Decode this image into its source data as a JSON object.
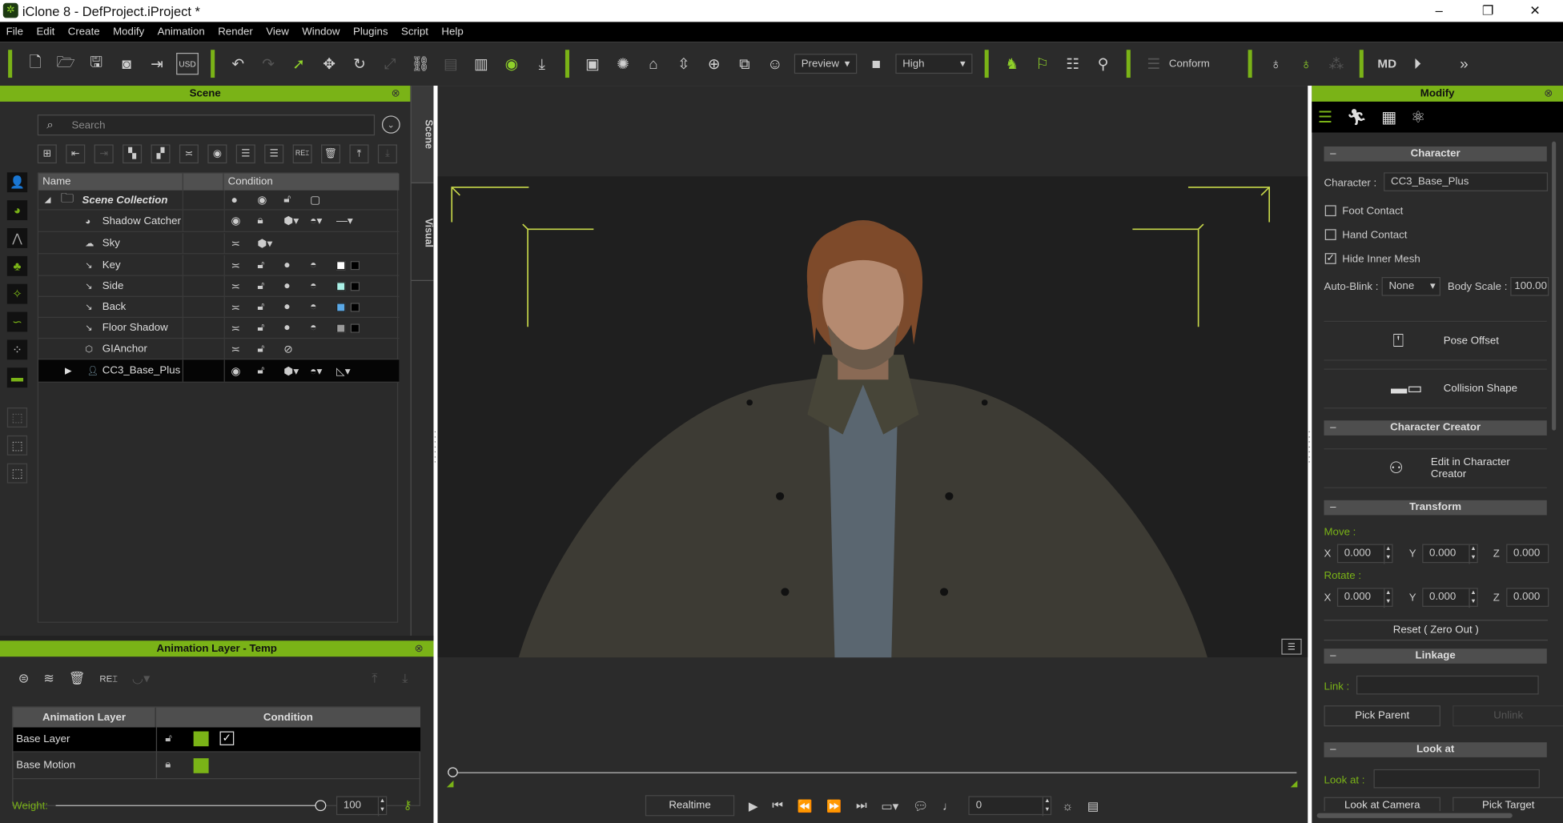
{
  "window": {
    "title": "iClone 8 - DefProject.iProject *",
    "controls": [
      "–",
      "❐",
      "✕"
    ]
  },
  "menu": [
    "File",
    "Edit",
    "Create",
    "Modify",
    "Animation",
    "Render",
    "View",
    "Window",
    "Plugins",
    "Script",
    "Help"
  ],
  "toolbar": {
    "preview_mode": "Preview",
    "quality": "High",
    "conform_label": "Conform"
  },
  "scene_panel": {
    "title": "Scene",
    "search_placeholder": "Search",
    "side_tabs": [
      "Scene",
      "Visual"
    ],
    "columns": [
      "Name",
      "Condition"
    ],
    "rows": [
      {
        "name": "Scene Collection",
        "icon": "folder-icon"
      },
      {
        "name": "Shadow Catcher",
        "icon": "shadow-catcher-icon"
      },
      {
        "name": "Sky",
        "icon": "cloud-icon"
      },
      {
        "name": "Key",
        "icon": "light-icon",
        "color": "#ffffff"
      },
      {
        "name": "Side",
        "icon": "light-icon",
        "color": "#aaf0e6"
      },
      {
        "name": "Back",
        "icon": "light-icon",
        "color": "#5aa8e6"
      },
      {
        "name": "Floor Shadow",
        "icon": "light-icon",
        "color": "#9a9a9a"
      },
      {
        "name": "GIAnchor",
        "icon": "anchor-icon"
      },
      {
        "name": "CC3_Base_Plus",
        "icon": "person-icon",
        "selected": true
      }
    ]
  },
  "anim_layer": {
    "title": "Animation Layer - Temp",
    "columns": [
      "Animation Layer",
      "Condition"
    ],
    "rows": [
      {
        "name": "Base Layer",
        "checked": true
      },
      {
        "name": "Base Motion",
        "checked": false
      }
    ],
    "weight_label": "Weight:",
    "weight": "100",
    "weight_fraction": 1.0,
    "layer_color": "#7ab317"
  },
  "timeline": {
    "realtime_label": "Realtime",
    "frame": "0",
    "position_fraction": 0
  },
  "modify": {
    "title": "Modify",
    "character": {
      "header": "Character",
      "character_label": "Character :",
      "character_value": "CC3_Base_Plus",
      "foot_contact": "Foot Contact",
      "hand_contact": "Hand Contact",
      "hide_inner_mesh": "Hide Inner Mesh",
      "auto_blink_label": "Auto-Blink :",
      "auto_blink_value": "None",
      "body_scale_label": "Body Scale :",
      "body_scale_value": "100.00",
      "pose_offset": "Pose Offset",
      "collision_shape": "Collision Shape"
    },
    "cc": {
      "header": "Character Creator",
      "edit": "Edit in Character Creator"
    },
    "transform": {
      "header": "Transform",
      "move_label": "Move :",
      "rotate_label": "Rotate :",
      "move": {
        "x": "0.000",
        "y": "0.000",
        "z": "0.000"
      },
      "rotate": {
        "x": "0.000",
        "y": "0.000",
        "z": "0.000"
      },
      "axes": [
        "X",
        "Y",
        "Z"
      ],
      "reset": "Reset ( Zero Out )"
    },
    "linkage": {
      "header": "Linkage",
      "link_label": "Link :",
      "pick_parent": "Pick Parent",
      "unlink": "Unlink"
    },
    "lookat": {
      "header": "Look at",
      "label": "Look at :",
      "look_at_camera": "Look at Camera",
      "pick_target": "Pick Target"
    }
  }
}
